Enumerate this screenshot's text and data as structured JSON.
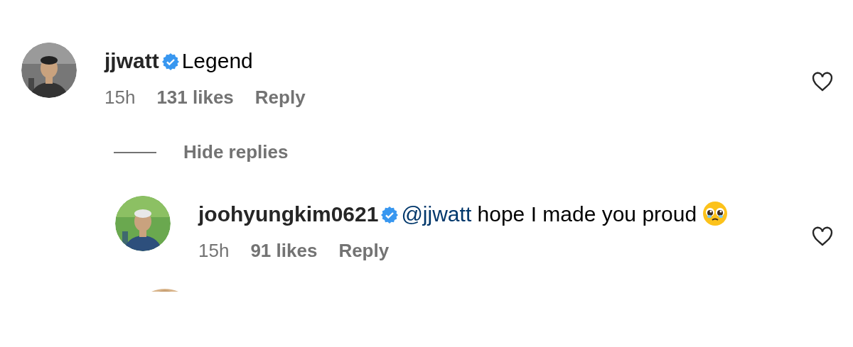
{
  "comments": [
    {
      "username": "jjwatt",
      "verified": true,
      "text": "Legend",
      "time": "15h",
      "likes": "131 likes",
      "reply": "Reply",
      "liked": false,
      "hide_replies": "Hide replies",
      "replies": [
        {
          "username": "joohyungkim0621",
          "verified": true,
          "mention": "@jjwatt",
          "text": "hope I made you proud",
          "emoji": true,
          "time": "15h",
          "likes": "91 likes",
          "reply": "Reply",
          "liked": false
        }
      ]
    }
  ]
}
